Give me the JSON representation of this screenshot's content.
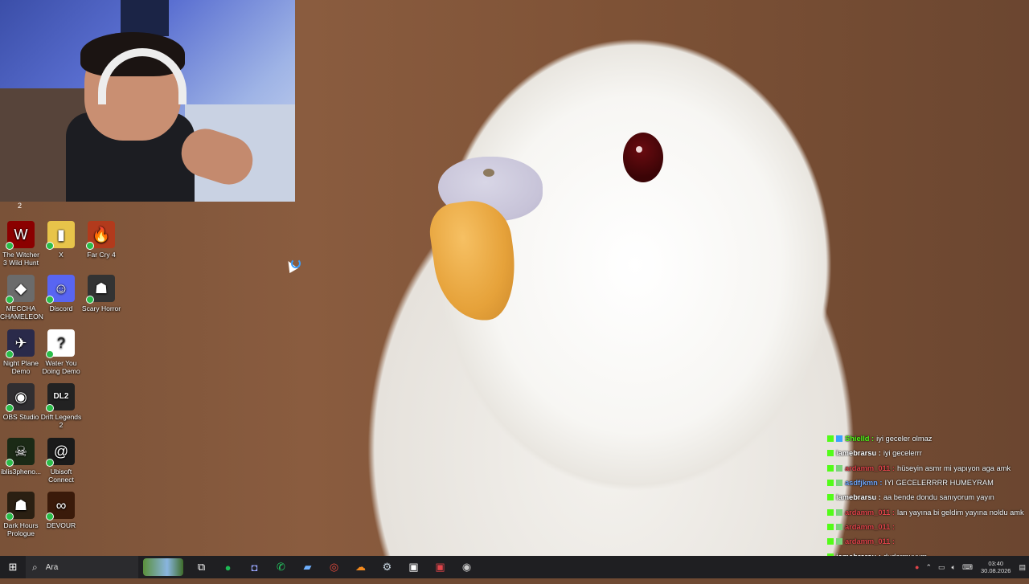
{
  "webcam": {
    "footer_label": "2"
  },
  "desktop_icons": [
    {
      "label": "The Witcher 3 Wild Hunt",
      "icon": "witcher-icon",
      "color": "#8b0000",
      "glyph": "W"
    },
    {
      "label": "X",
      "icon": "folder-icon",
      "color": "#e8c44a",
      "glyph": "▮"
    },
    {
      "label": "Far Cry 4",
      "icon": "farcry-icon",
      "color": "#b23a1c",
      "glyph": "🔥"
    },
    {
      "label": "MECCHA CHAMELEON",
      "icon": "chameleon-icon",
      "color": "#6b6b6b",
      "glyph": "◆"
    },
    {
      "label": "Discord",
      "icon": "discord-icon",
      "color": "#5865f2",
      "glyph": "☺"
    },
    {
      "label": "Scary Horror",
      "icon": "horror-icon",
      "color": "#333333",
      "glyph": "☗"
    },
    {
      "label": "Night Plane Demo",
      "icon": "plane-icon",
      "color": "#2a2a4a",
      "glyph": "✈"
    },
    {
      "label": "Water You Doing Demo",
      "icon": "question-icon",
      "color": "#ffffff",
      "glyph": "?"
    },
    {
      "label": "OBS Studio",
      "icon": "obs-icon",
      "color": "#302e31",
      "glyph": "◉"
    },
    {
      "label": "Drift Legends 2",
      "icon": "drift-icon",
      "color": "#222222",
      "glyph": "DL2"
    },
    {
      "label": "iblis3pheno...",
      "icon": "iblis-icon",
      "color": "#1b2a16",
      "glyph": "☠"
    },
    {
      "label": "Ubisoft Connect",
      "icon": "ubisoft-icon",
      "color": "#1a1a1a",
      "glyph": "@"
    },
    {
      "label": "Dark Hours Prologue",
      "icon": "darkhours-icon",
      "color": "#2a1f12",
      "glyph": "☗"
    },
    {
      "label": "DEVOUR",
      "icon": "devour-icon",
      "color": "#3a1a0a",
      "glyph": "∞"
    }
  ],
  "chat": [
    {
      "user": "Shielld",
      "message": "iyi geceler olmaz",
      "color": "#53fc18"
    },
    {
      "user": "iamebrarsu",
      "message": "iyi gecelerrr",
      "color": "#ffffff"
    },
    {
      "user": "ardamm_011",
      "message": "hüseyin asmr mi yapıyon aga amk",
      "color": "#e0444a"
    },
    {
      "user": "asdfjkmn",
      "message": "IYI GECELERRRR HUMEYRAM",
      "color": "#6fa8ff"
    },
    {
      "user": "iamebrarsu",
      "message": "aa bende dondu sanıyorum yayın",
      "color": "#ffffff"
    },
    {
      "user": "ardamm_011",
      "message": "lan yayına bi geldim yayına noldu amk",
      "color": "#e0444a"
    },
    {
      "user": "ardamm_011",
      "message": "",
      "color": "#e0444a"
    },
    {
      "user": "ardamm_011",
      "message": "",
      "color": "#e0444a"
    },
    {
      "user": "iamebrarsu",
      "message": "dudarmuyum.",
      "color": "#ffffff"
    }
  ],
  "taskbar": {
    "start_icon": "windows-start-icon",
    "search_placeholder": "Ara",
    "apps": [
      {
        "icon": "task-view-icon",
        "glyph": "⧉",
        "color": "#ffffff"
      },
      {
        "icon": "spotify-icon",
        "glyph": "●",
        "color": "#1db954"
      },
      {
        "icon": "camera-app-icon",
        "glyph": "◘",
        "color": "#9aa7ff"
      },
      {
        "icon": "whatsapp-icon",
        "glyph": "✆",
        "color": "#25d366"
      },
      {
        "icon": "files-icon",
        "glyph": "▰",
        "color": "#6fb1ff"
      },
      {
        "icon": "chrome-icon",
        "glyph": "◎",
        "color": "#e84a3c"
      },
      {
        "icon": "cloud-app-icon",
        "glyph": "☁",
        "color": "#f48a1e"
      },
      {
        "icon": "steam-icon",
        "glyph": "⚙",
        "color": "#c7d5e0"
      },
      {
        "icon": "kick-app-icon",
        "glyph": "▣",
        "color": "#ffffff"
      },
      {
        "icon": "stream-app-icon",
        "glyph": "▣",
        "color": "#e0444a"
      },
      {
        "icon": "obs-taskbar-icon",
        "glyph": "◉",
        "color": "#cccccc"
      }
    ],
    "clock_time": "03:40",
    "clock_date": "30.08.2026"
  }
}
